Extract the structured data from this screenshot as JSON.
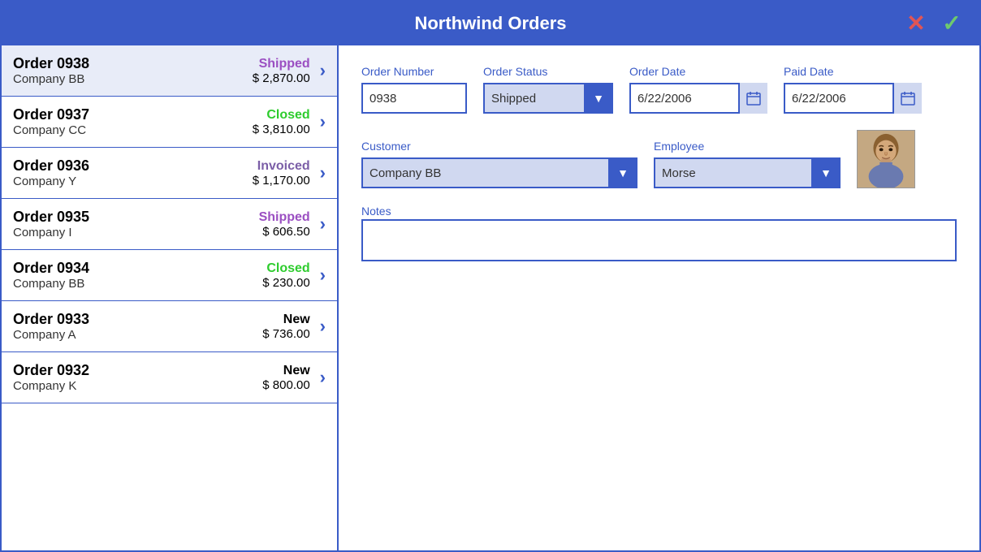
{
  "app": {
    "title": "Northwind Orders",
    "close_btn": "✕",
    "check_btn": "✓"
  },
  "orders": [
    {
      "id": "Order 0938",
      "company": "Company BB",
      "status": "Shipped",
      "status_class": "status-shipped",
      "amount": "$ 2,870.00"
    },
    {
      "id": "Order 0937",
      "company": "Company CC",
      "status": "Closed",
      "status_class": "status-closed",
      "amount": "$ 3,810.00"
    },
    {
      "id": "Order 0936",
      "company": "Company Y",
      "status": "Invoiced",
      "status_class": "status-invoiced",
      "amount": "$ 1,170.00"
    },
    {
      "id": "Order 0935",
      "company": "Company I",
      "status": "Shipped",
      "status_class": "status-shipped",
      "amount": "$ 606.50"
    },
    {
      "id": "Order 0934",
      "company": "Company BB",
      "status": "Closed",
      "status_class": "status-closed",
      "amount": "$ 230.00"
    },
    {
      "id": "Order 0933",
      "company": "Company A",
      "status": "New",
      "status_class": "status-new",
      "amount": "$ 736.00"
    },
    {
      "id": "Order 0932",
      "company": "Company K",
      "status": "New",
      "status_class": "status-new",
      "amount": "$ 800.00"
    }
  ],
  "detail": {
    "order_number_label": "Order Number",
    "order_number_value": "0938",
    "order_status_label": "Order Status",
    "order_status_value": "Shipped",
    "order_date_label": "Order Date",
    "order_date_value": "6/22/2006",
    "paid_date_label": "Paid Date",
    "paid_date_value": "6/22/2006",
    "customer_label": "Customer",
    "customer_value": "Company BB",
    "employee_label": "Employee",
    "employee_value": "Morse",
    "notes_label": "Notes",
    "notes_value": "",
    "status_options": [
      "New",
      "Invoiced",
      "Shipped",
      "Closed"
    ],
    "customer_options": [
      "Company A",
      "Company BB",
      "Company CC",
      "Company I",
      "Company K",
      "Company Y"
    ]
  }
}
